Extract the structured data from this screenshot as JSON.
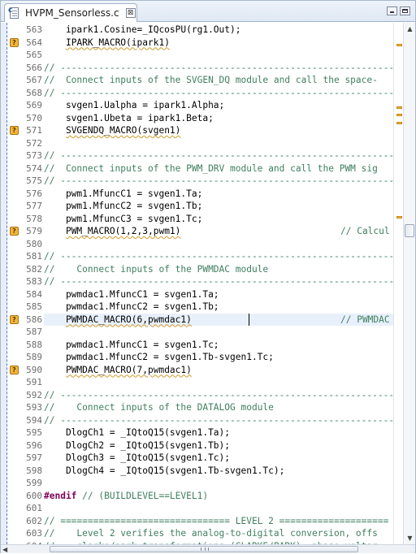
{
  "tab": {
    "icon": "c-source-file-icon",
    "label": "HVPM_Sensorless.c",
    "close_glyph": "⊠"
  },
  "window_controls": {
    "minimize": "minimize-icon",
    "maximize": "maximize-icon"
  },
  "colors": {
    "comment": "#3f7f5f",
    "keyword": "#7f0055",
    "marker": "#f2b43a",
    "current_line": "#e8f0fb"
  },
  "editor": {
    "current_line": 586,
    "lines": [
      {
        "num": "563",
        "text": "    ipark1.Cosine=_IQcosPU(rg1.Out);",
        "marker": false,
        "type": "code"
      },
      {
        "num": "564",
        "text": "    IPARK_MACRO(ipark1)",
        "marker": true,
        "type": "code"
      },
      {
        "num": "565",
        "text": "",
        "marker": false,
        "type": "code"
      },
      {
        "num": "566",
        "text": "// ---------------------------------------------------------------",
        "marker": false,
        "type": "comment"
      },
      {
        "num": "567",
        "text": "//  Connect inputs of the SVGEN_DQ module and call the space-",
        "marker": false,
        "type": "comment"
      },
      {
        "num": "568",
        "text": "// ---------------------------------------------------------------",
        "marker": false,
        "type": "comment"
      },
      {
        "num": "569",
        "text": "    svgen1.Ualpha = ipark1.Alpha;",
        "marker": false,
        "type": "code"
      },
      {
        "num": "570",
        "text": "    svgen1.Ubeta = ipark1.Beta;",
        "marker": false,
        "type": "code"
      },
      {
        "num": "571",
        "text": "    SVGENDQ_MACRO(svgen1)",
        "marker": true,
        "type": "code"
      },
      {
        "num": "572",
        "text": "",
        "marker": false,
        "type": "code"
      },
      {
        "num": "573",
        "text": "// ---------------------------------------------------------------",
        "marker": false,
        "type": "comment"
      },
      {
        "num": "574",
        "text": "//  Connect inputs of the PWM_DRV module and call the PWM sig",
        "marker": false,
        "type": "comment"
      },
      {
        "num": "575",
        "text": "// ---------------------------------------------------------------",
        "marker": false,
        "type": "comment"
      },
      {
        "num": "576",
        "text": "    pwm1.MfuncC1 = svgen1.Ta;",
        "marker": false,
        "type": "code"
      },
      {
        "num": "577",
        "text": "    pwm1.MfuncC2 = svgen1.Tb;",
        "marker": false,
        "type": "code"
      },
      {
        "num": "578",
        "text": "    pwm1.MfuncC3 = svgen1.Tc;",
        "marker": false,
        "type": "code"
      },
      {
        "num": "579",
        "text": "    PWM_MACRO(1,2,3,pwm1)",
        "marker": true,
        "type": "code",
        "tail": "// Calcul"
      },
      {
        "num": "580",
        "text": "",
        "marker": false,
        "type": "code"
      },
      {
        "num": "581",
        "text": "// ---------------------------------------------------------------",
        "marker": false,
        "type": "comment"
      },
      {
        "num": "582",
        "text": "//    Connect inputs of the PWMDAC module",
        "marker": false,
        "type": "comment"
      },
      {
        "num": "583",
        "text": "// ---------------------------------------------------------------",
        "marker": false,
        "type": "comment"
      },
      {
        "num": "584",
        "text": "    pwmdac1.MfuncC1 = svgen1.Ta;",
        "marker": false,
        "type": "code"
      },
      {
        "num": "585",
        "text": "    pwmdac1.MfuncC2 = svgen1.Tb;",
        "marker": false,
        "type": "code"
      },
      {
        "num": "586",
        "text": "    PWMDAC_MACRO(6,pwmdac1)",
        "marker": true,
        "type": "code",
        "tail": "// PWMDAC"
      },
      {
        "num": "587",
        "text": "",
        "marker": false,
        "type": "code"
      },
      {
        "num": "588",
        "text": "    pwmdac1.MfuncC1 = svgen1.Tc;",
        "marker": false,
        "type": "code"
      },
      {
        "num": "589",
        "text": "    pwmdac1.MfuncC2 = svgen1.Tb-svgen1.Tc;",
        "marker": false,
        "type": "code"
      },
      {
        "num": "590",
        "text": "    PWMDAC_MACRO(7,pwmdac1)",
        "marker": true,
        "type": "code"
      },
      {
        "num": "591",
        "text": "",
        "marker": false,
        "type": "code"
      },
      {
        "num": "592",
        "text": "// ---------------------------------------------------------------",
        "marker": false,
        "type": "comment"
      },
      {
        "num": "593",
        "text": "//    Connect inputs of the DATALOG module",
        "marker": false,
        "type": "comment"
      },
      {
        "num": "594",
        "text": "// ---------------------------------------------------------------",
        "marker": false,
        "type": "comment"
      },
      {
        "num": "595",
        "text": "    DlogCh1 = _IQtoQ15(svgen1.Ta);",
        "marker": false,
        "type": "code"
      },
      {
        "num": "596",
        "text": "    DlogCh2 = _IQtoQ15(svgen1.Tb);",
        "marker": false,
        "type": "code"
      },
      {
        "num": "597",
        "text": "    DlogCh3 = _IQtoQ15(svgen1.Tc);",
        "marker": false,
        "type": "code"
      },
      {
        "num": "598",
        "text": "    DlogCh4 = _IQtoQ15(svgen1.Tb-svgen1.Tc);",
        "marker": false,
        "type": "code"
      },
      {
        "num": "599",
        "text": "",
        "marker": false,
        "type": "code"
      },
      {
        "num": "600",
        "text": "#endif // (BUILDLEVEL==LEVEL1)",
        "marker": false,
        "type": "endif"
      },
      {
        "num": "601",
        "text": "",
        "marker": false,
        "type": "code"
      },
      {
        "num": "602",
        "text": "// =============================== LEVEL 2 ====================",
        "marker": false,
        "type": "comment"
      },
      {
        "num": "603",
        "text": "//    Level 2 verifies the analog-to-digital conversion, offs",
        "marker": false,
        "type": "comment"
      },
      {
        "num": "604",
        "text": "//    clarke/park transformations (CLARKE/PARK), phase voltag",
        "marker": false,
        "type": "comment"
      }
    ]
  },
  "overview_marks": [
    0.04,
    0.16,
    0.175,
    0.19,
    0.37
  ]
}
